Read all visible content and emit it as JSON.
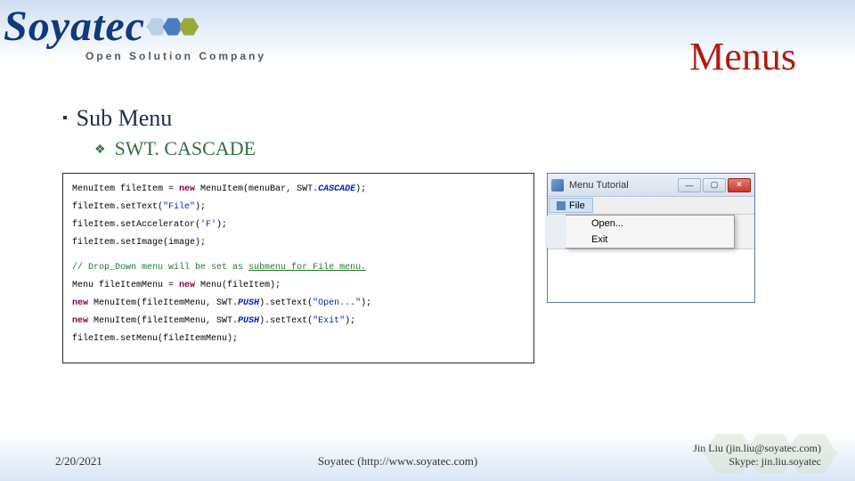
{
  "logo": {
    "name": "Soyatec",
    "tagline": "Open Solution Company"
  },
  "slide": {
    "title": "Menus",
    "heading": "Sub Menu",
    "subheading": "SWT. CASCADE"
  },
  "code": {
    "l1a": "MenuItem fileItem = ",
    "l1b": "new",
    "l1c": " MenuItem(menuBar, SWT.",
    "l1d": "CASCADE",
    "l1e": ");",
    "l2a": "fileItem.setText(",
    "l2b": "\"File\"",
    "l2c": ");",
    "l3a": "fileItem.setAccelerator(",
    "l3b": "'F'",
    "l3c": ");",
    "l4": "fileItem.setImage(image);",
    "l5a": "// Drop_Down menu will be set as ",
    "l5b": "submenu",
    "l5c": " for File menu.",
    "l6a": "Menu fileItemMenu = ",
    "l6b": "new",
    "l6c": " Menu(fileItem);",
    "l7a": "new",
    "l7b": " MenuItem(fileItemMenu, SWT.",
    "l7c": "PUSH",
    "l7d": ").setText(",
    "l7e": "\"Open...\"",
    "l7f": ");",
    "l8a": "new",
    "l8b": " MenuItem(fileItemMenu, SWT.",
    "l8c": "PUSH",
    "l8d": ").setText(",
    "l8e": "\"Exit\"",
    "l8f": ");",
    "l9": "fileItem.setMenu(fileItemMenu);"
  },
  "window": {
    "title": "Menu Tutorial",
    "menu_file": "File",
    "dd_open": "Open...",
    "dd_exit": "Exit"
  },
  "footer": {
    "date": "2/20/2021",
    "center": "Soyatec (http://www.soyatec.com)",
    "author": "Jin Liu (jin.liu@soyatec.com)",
    "skype": "Skype: jin.liu.soyatec"
  }
}
